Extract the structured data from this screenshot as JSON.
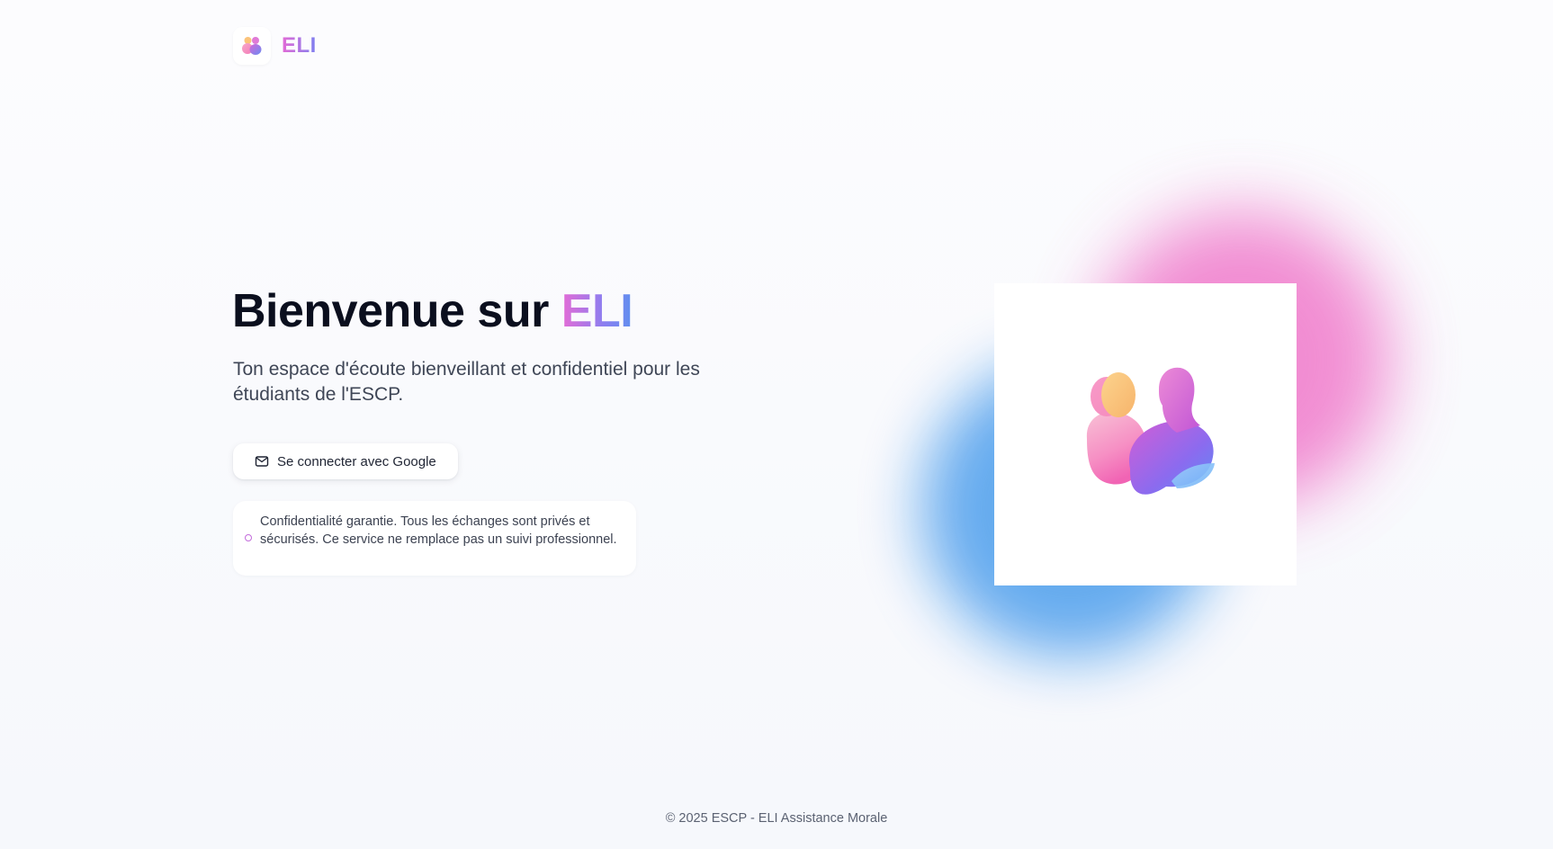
{
  "brand": {
    "name": "ELI",
    "logo_icon": "two-people-icon"
  },
  "hero": {
    "title_prefix": "Bienvenue sur ",
    "title_accent": "ELI",
    "subtitle": "Ton espace d'écoute bienveillant et confidentiel pour les étudiants de l'ESCP.",
    "login_button": {
      "label": "Se connecter avec Google",
      "icon": "mail-icon"
    },
    "notice": {
      "icon": "circle-icon",
      "text": "Confidentialité garantie. Tous les échanges sont privés et sécurisés. Ce service ne remplace pas un suivi professionnel."
    },
    "illustration": {
      "icon": "two-people-illustration"
    }
  },
  "footer": {
    "text": "© 2025 ESCP - ELI Assistance Morale"
  },
  "colors": {
    "accent_pink": "#e46bd6",
    "accent_blue": "#5f8fef",
    "blob_pink": "#f07acb",
    "blob_blue": "#5ea7ee",
    "title": "#0b0f1e"
  }
}
